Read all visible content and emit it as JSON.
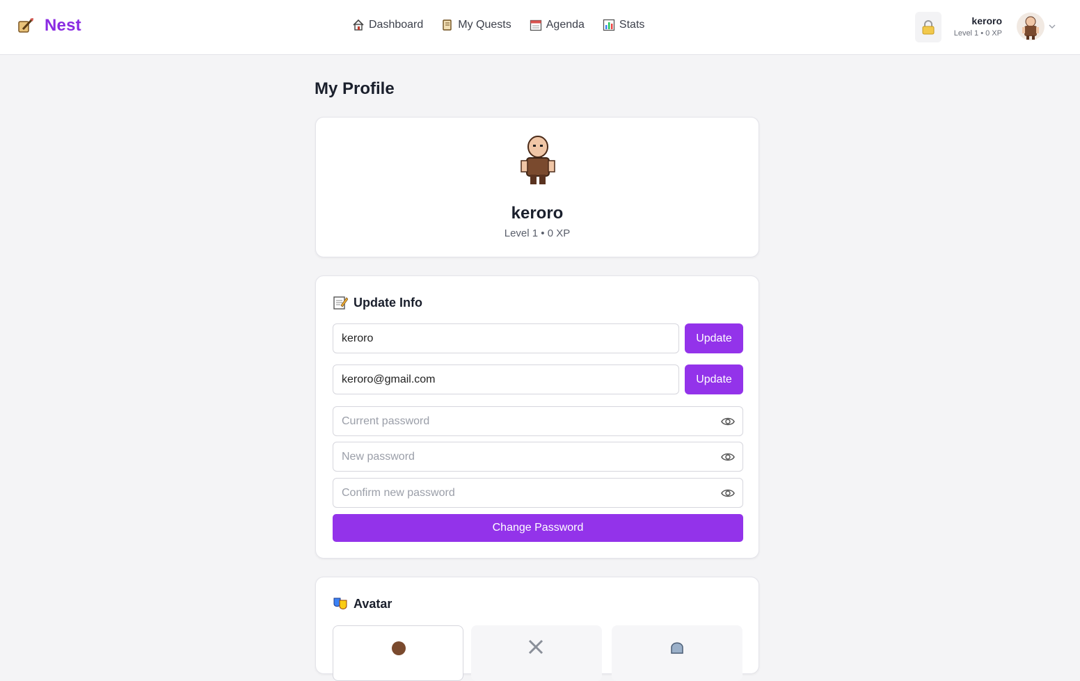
{
  "header": {
    "brand": "Nest",
    "nav": [
      {
        "label": "Dashboard",
        "icon": "house-icon"
      },
      {
        "label": "My Quests",
        "icon": "scroll-icon"
      },
      {
        "label": "Agenda",
        "icon": "calendar-icon"
      },
      {
        "label": "Stats",
        "icon": "bar-chart-icon"
      }
    ],
    "user": {
      "name": "keroro",
      "level": "Level 1 • 0 XP"
    }
  },
  "page": {
    "title": "My Profile"
  },
  "profile": {
    "name": "keroro",
    "level": "Level 1 • 0 XP"
  },
  "update_info": {
    "heading": "Update Info",
    "username_value": "keroro",
    "email_value": "keroro@gmail.com",
    "update_label": "Update",
    "current_password_placeholder": "Current password",
    "new_password_placeholder": "New password",
    "confirm_password_placeholder": "Confirm new password",
    "change_password_label": "Change Password"
  },
  "avatar_section": {
    "heading": "Avatar"
  },
  "colors": {
    "accent": "#9333ea",
    "brand": "#8a2be2"
  }
}
